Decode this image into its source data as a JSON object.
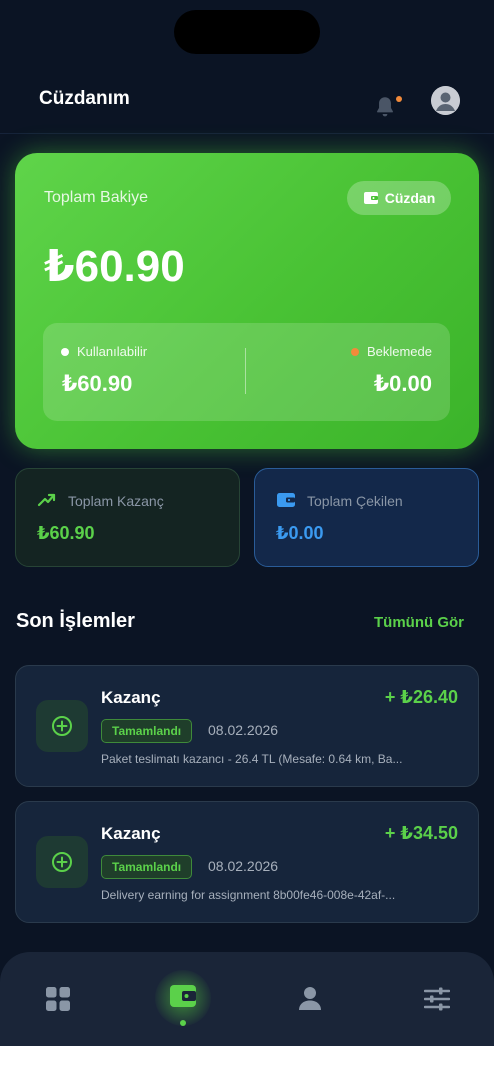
{
  "header": {
    "title": "Cüzdanım"
  },
  "balance_card": {
    "label": "Toplam Bakiye",
    "wallet_button": "Cüzdan",
    "amount": "₺60.90",
    "available_label": "Kullanılabilir",
    "available_amount": "₺60.90",
    "pending_label": "Beklemede",
    "pending_amount": "₺0.00"
  },
  "stats": {
    "earned_label": "Toplam Kazanç",
    "earned_value": "₺60.90",
    "withdrawn_label": "Toplam Çekilen",
    "withdrawn_value": "₺0.00"
  },
  "transactions_section": {
    "title": "Son İşlemler",
    "see_all": "Tümünü Gör"
  },
  "transactions": [
    {
      "title": "Kazanç",
      "amount": "+ ₺26.40",
      "status": "Tamamlandı",
      "date": "08.02.2026",
      "description": "Paket teslimatı kazancı - 26.4 TL (Mesafe: 0.64 km, Ba..."
    },
    {
      "title": "Kazanç",
      "amount": "+ ₺34.50",
      "status": "Tamamlandı",
      "date": "08.02.2026",
      "description": "Delivery earning for assignment 8b00fe46-008e-42af-..."
    }
  ],
  "colors": {
    "background": "#0b1424",
    "accent_green": "#5bd14a",
    "accent_blue": "#3b9af0",
    "pending_orange": "#f28a3a"
  },
  "nav": {
    "items": [
      "grid-icon",
      "wallet-icon",
      "user-icon",
      "sliders-icon"
    ],
    "active": "wallet-icon"
  }
}
